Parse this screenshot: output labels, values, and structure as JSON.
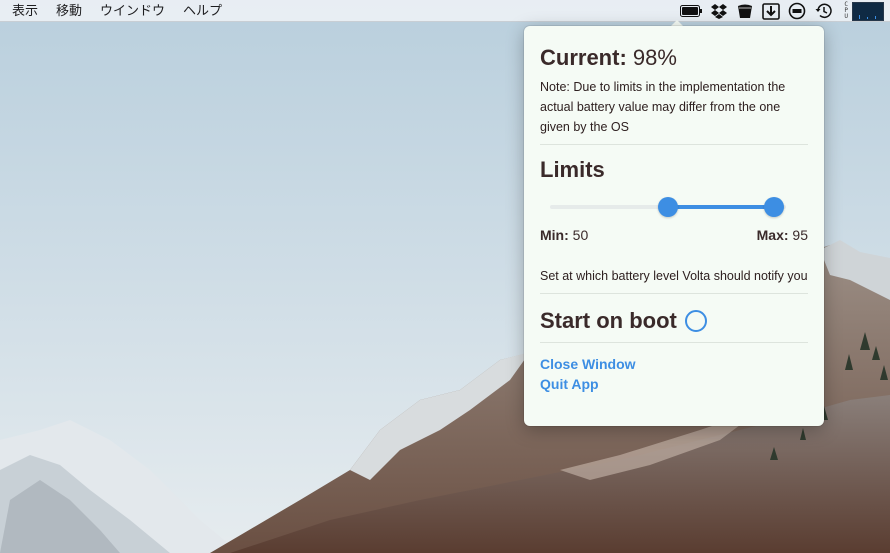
{
  "menubar": {
    "items": [
      "表示",
      "移動",
      "ウインドウ",
      "ヘルプ"
    ],
    "status_icons": [
      "battery-icon",
      "dropbox-icon",
      "volta-icon",
      "download-icon",
      "sync-icon",
      "time-machine-icon",
      "cpu-meter-icon"
    ],
    "cpu_letters": [
      "C",
      "P",
      "U"
    ]
  },
  "popover": {
    "current_label": "Current:",
    "current_value": "98%",
    "note": "Note: Due to limits in the implementation the actual battery value may differ from the one given by the OS",
    "limits_title": "Limits",
    "slider": {
      "min_value": 50,
      "max_value": 95,
      "range_min": 0,
      "range_max": 100
    },
    "min_label": "Min:",
    "min_value": "50",
    "max_label": "Max:",
    "max_value": "95",
    "hint": "Set at which battery level Volta should notify you",
    "start_on_boot_label": "Start on boot",
    "start_on_boot_checked": false,
    "close_window_label": "Close Window",
    "quit_app_label": "Quit App"
  },
  "colors": {
    "accent": "#3d8ee3",
    "popover_bg": "#f5fbf5",
    "text": "#3a2a2a"
  }
}
